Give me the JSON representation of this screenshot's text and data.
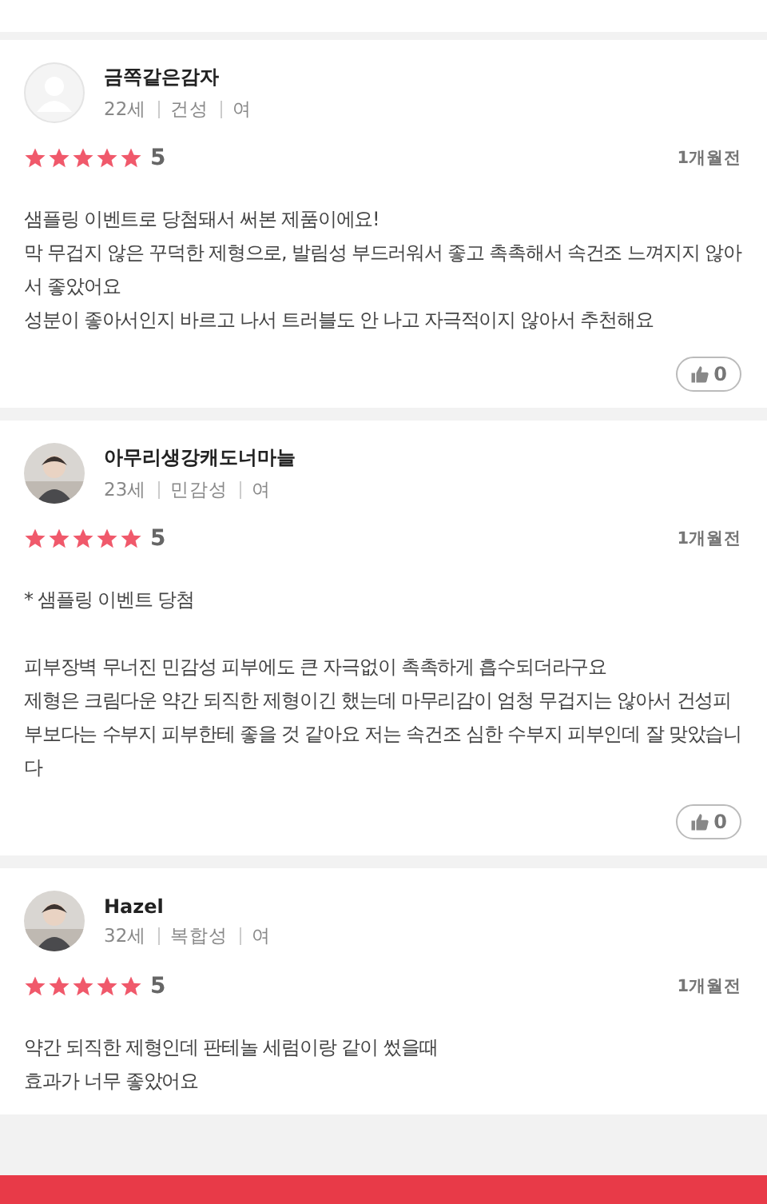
{
  "reviews": [
    {
      "avatar": {
        "kind": "placeholder"
      },
      "name": "금쪽같은감자",
      "age": "22세",
      "skin": "건성",
      "gender": "여",
      "stars": 5,
      "score": "5",
      "date": "1개월전",
      "paragraphs": [
        "샘플링 이벤트로 당첨돼서 써본 제품이에요!\n막 무겁지 않은 꾸덕한 제형으로, 발림성 부드러워서 좋고 촉촉해서 속건조 느껴지지 않아서 좋았어요\n성분이 좋아서인지 바르고 나서 트러블도 안 나고 자극적이지 않아서 추천해요"
      ],
      "likes": "0"
    },
    {
      "avatar": {
        "kind": "picture"
      },
      "name": "아무리생강캐도너마늘",
      "age": "23세",
      "skin": "민감성",
      "gender": "여",
      "stars": 5,
      "score": "5",
      "date": "1개월전",
      "paragraphs": [
        "* 샘플링 이벤트 당첨",
        "피부장벽 무너진 민감성 피부에도 큰 자극없이 촉촉하게 흡수되더라구요\n제형은 크림다운 약간 되직한 제형이긴 했는데 마무리감이 엄청 무겁지는 않아서 건성피부보다는 수부지 피부한테 좋을 것 같아요 저는 속건조 심한 수부지 피부인데 잘 맞았습니다"
      ],
      "likes": "0"
    },
    {
      "avatar": {
        "kind": "picture"
      },
      "name": "Hazel",
      "age": "32세",
      "skin": "복합성",
      "gender": "여",
      "stars": 5,
      "score": "5",
      "date": "1개월전",
      "paragraphs": [
        "약간 되직한 제형인데 판테놀 세럼이랑 같이 썼을때\n효과가 너무 좋았어요"
      ]
    }
  ]
}
